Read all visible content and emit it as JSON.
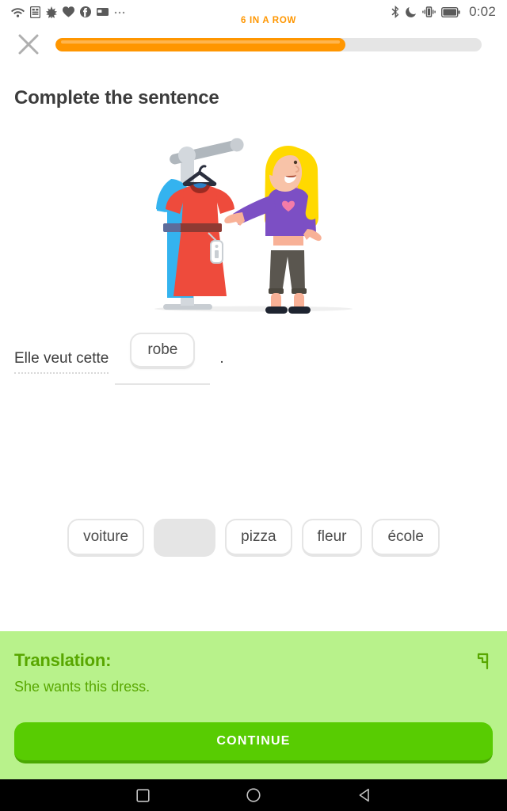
{
  "status_bar": {
    "left_icons": [
      "wifi-icon",
      "sim-card-icon",
      "leaf-icon",
      "heart-icon",
      "facebook-icon",
      "card-icon",
      "more-icon"
    ],
    "right_icons": [
      "bluetooth-icon",
      "do-not-disturb-moon-icon",
      "vibrate-icon",
      "battery-icon"
    ],
    "time": "0:02"
  },
  "top_bar": {
    "close_icon": "close-x-icon",
    "streak_label": "6 IN A ROW",
    "progress_percent": 68,
    "progress_fill_color": "#ff9600",
    "progress_track_color": "#e5e5e5"
  },
  "challenge": {
    "title": "Complete the sentence",
    "illustration_name": "woman-pointing-at-red-dress-on-rack"
  },
  "sentence": {
    "prefix": "Elle veut cette",
    "filled_word": "robe",
    "punctuation": "."
  },
  "word_bank": {
    "tiles": [
      {
        "label": "voiture",
        "used": false
      },
      {
        "label": "robe",
        "used": true
      },
      {
        "label": "pizza",
        "used": false
      },
      {
        "label": "fleur",
        "used": false
      },
      {
        "label": "école",
        "used": false
      }
    ]
  },
  "feedback": {
    "header": "Translation:",
    "text": "She wants this dress.",
    "report_icon": "report-flag-icon",
    "continue_label": "CONTINUE",
    "panel_color": "#b8f28b",
    "accent_color": "#58a700",
    "button_color": "#58cc02"
  },
  "nav_bar": {
    "recents_icon": "recents-square-icon",
    "home_icon": "home-circle-icon",
    "back_icon": "back-triangle-icon"
  }
}
